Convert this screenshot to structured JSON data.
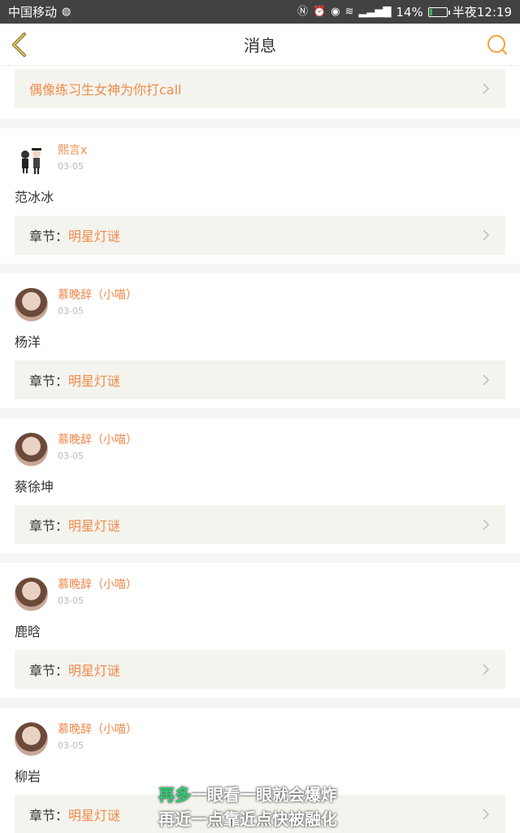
{
  "status_bar": {
    "carrier": "中国移动",
    "battery_percent": "14%",
    "time": "半夜12:19",
    "battery_level": 0.14
  },
  "header": {
    "title": "消息"
  },
  "top_link": {
    "text": "偶像练习生女神为你打call"
  },
  "chapter_label": "章节：",
  "messages": [
    {
      "name": "熙言x",
      "date": "03-05",
      "body": "范冰冰",
      "chapter": "明星灯谜",
      "avatar": "cartoon-couple"
    },
    {
      "name": "慕晚辞（小喵）",
      "date": "03-05",
      "body": "杨洋",
      "chapter": "明星灯谜",
      "avatar": "girl-photo"
    },
    {
      "name": "慕晚辞（小喵）",
      "date": "03-05",
      "body": "蔡徐坤",
      "chapter": "明星灯谜",
      "avatar": "girl-photo"
    },
    {
      "name": "慕晚辞（小喵）",
      "date": "03-05",
      "body": "鹿晗",
      "chapter": "明星灯谜",
      "avatar": "girl-photo"
    },
    {
      "name": "慕晚辞（小喵）",
      "date": "03-05",
      "body": "柳岩",
      "chapter": "明星灯谜",
      "avatar": "girl-photo"
    }
  ],
  "overlay": {
    "line1_highlight": "再多",
    "line1_rest": "一眼看一眼就会爆炸",
    "line2": "再近一点靠近点快被融化"
  },
  "colors": {
    "accent": "#f08a4b",
    "statusbar": "#424242",
    "card_bg": "#f4f4ee"
  }
}
